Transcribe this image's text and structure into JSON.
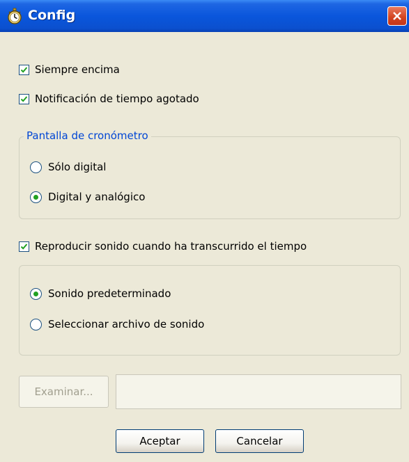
{
  "window": {
    "title": "Config",
    "icon": "stopwatch-icon",
    "close_icon": "close-icon"
  },
  "options": {
    "always_on_top": {
      "label": "Siempre encima",
      "checked": true
    },
    "timeout_notification": {
      "label": "Notificación de tiempo agotado",
      "checked": true
    }
  },
  "stopwatch_display": {
    "legend": "Pantalla de cronómetro",
    "options": [
      {
        "label": "Sólo digital",
        "selected": false
      },
      {
        "label": "Digital y analógico",
        "selected": true
      }
    ]
  },
  "sound": {
    "checkbox_label": "Reproducir sonido cuando ha transcurrido el tiempo",
    "checked": true,
    "options": [
      {
        "label": "Sonido predeterminado",
        "selected": true
      },
      {
        "label": "Seleccionar archivo de sonido",
        "selected": false
      }
    ],
    "browse_label": "Examinar...",
    "browse_enabled": false,
    "file_path": ""
  },
  "buttons": {
    "accept_label": "Aceptar",
    "cancel_label": "Cancelar"
  },
  "colors": {
    "titlebar": "#0A56DC",
    "window_bg": "#ECE9D8",
    "group_legend": "#0046D5",
    "check_mark": "#21A121"
  }
}
